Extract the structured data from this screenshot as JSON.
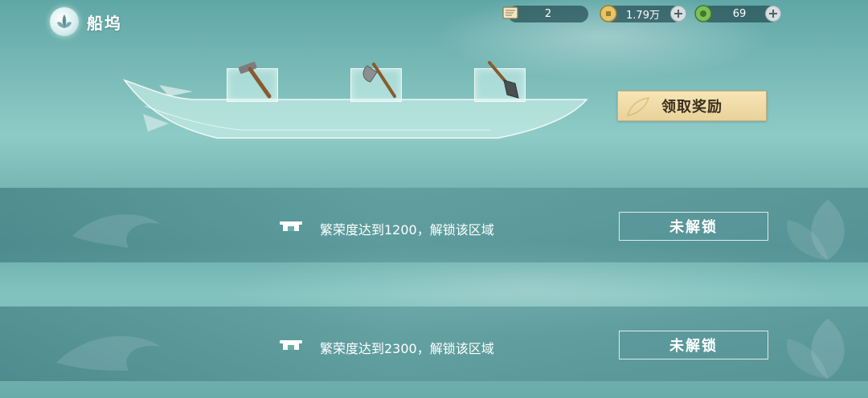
{
  "header": {
    "title": "船坞",
    "logo_icon": "lotus-emblem-icon"
  },
  "resources": [
    {
      "name": "scroll",
      "icon": "scroll-icon",
      "value": "2",
      "has_plus": false
    },
    {
      "name": "coin",
      "icon": "coin-icon",
      "value": "1.79万",
      "has_plus": true
    },
    {
      "name": "jade",
      "icon": "jade-icon",
      "value": "69",
      "has_plus": true
    }
  ],
  "boat": {
    "tools": [
      {
        "name": "hammer",
        "icon": "hammer-icon"
      },
      {
        "name": "axe",
        "icon": "axe-icon"
      },
      {
        "name": "shovel",
        "icon": "shovel-icon"
      }
    ]
  },
  "claim_reward": {
    "label": "领取奖励"
  },
  "unlock_rows": [
    {
      "condition": "繁荣度达到1200，解锁该区域",
      "status": "未解锁",
      "icon": "gate-icon"
    },
    {
      "condition": "繁荣度达到2300，解锁该区域",
      "status": "未解锁",
      "icon": "gate-icon"
    }
  ],
  "colors": {
    "accent_gold": "#e9d29a",
    "resource_bar": "#264e54",
    "water_teal": "#79bab7"
  }
}
